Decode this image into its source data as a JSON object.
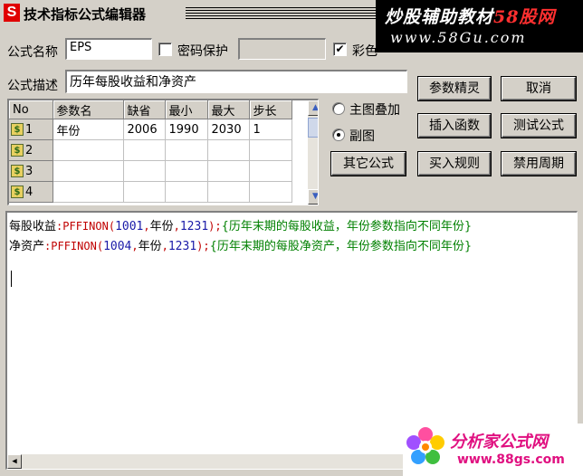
{
  "window": {
    "logo_letter": "S",
    "title": "技术指标公式编辑器"
  },
  "watermark_top": {
    "line1_a": "炒股辅助教材",
    "line1_b": "58股网",
    "line2": "www.58Gu.com"
  },
  "form": {
    "name_label": "公式名称",
    "name_value": "EPS",
    "password_label": "密码保护",
    "password_checked": false,
    "password_value": "",
    "color_label": "彩色",
    "color_checked": true,
    "desc_label": "公式描述",
    "desc_value": "历年每股收益和净资产"
  },
  "params": {
    "headers": [
      "No",
      "参数名",
      "缺省",
      "最小",
      "最大",
      "步长"
    ],
    "rows": [
      {
        "no": "1",
        "name": "年份",
        "default": "2006",
        "min": "1990",
        "max": "2030",
        "step": "1"
      },
      {
        "no": "2",
        "name": "",
        "default": "",
        "min": "",
        "max": "",
        "step": ""
      },
      {
        "no": "3",
        "name": "",
        "default": "",
        "min": "",
        "max": "",
        "step": ""
      },
      {
        "no": "4",
        "name": "",
        "default": "",
        "min": "",
        "max": "",
        "step": ""
      }
    ],
    "row_icon": "$"
  },
  "options": {
    "main_overlay": "主图叠加",
    "sub_chart": "副图",
    "selected": "sub_chart"
  },
  "buttons": {
    "param_wizard": "参数精灵",
    "cancel": "取消",
    "insert_function": "插入函数",
    "test_formula": "测试公式",
    "other_formula": "其它公式",
    "buy_rules": "买入规则",
    "disable_period": "禁用周期"
  },
  "editor": {
    "line1": {
      "name": "每股收益",
      "sep": ":",
      "fn": "PFFINON",
      "open": "(",
      "arg1": "1001",
      "comma1": ",",
      "arg2": "年份",
      "comma2": ",",
      "arg3": "1231",
      "close": ");",
      "comment": "{历年末期的每股收益，年份参数指向不同年份}"
    },
    "line2": {
      "name": "净资产",
      "sep": ":",
      "fn": "PFFINON",
      "open": "(",
      "arg1": "1004",
      "comma1": ",",
      "arg2": "年份",
      "comma2": ",",
      "arg3": "1231",
      "close": ");",
      "comment": "{历年末期的每股净资产，年份参数指向不同年份}"
    }
  },
  "watermark_bottom": {
    "line1": "分析家公式网",
    "line2": "www.88gs.com"
  }
}
